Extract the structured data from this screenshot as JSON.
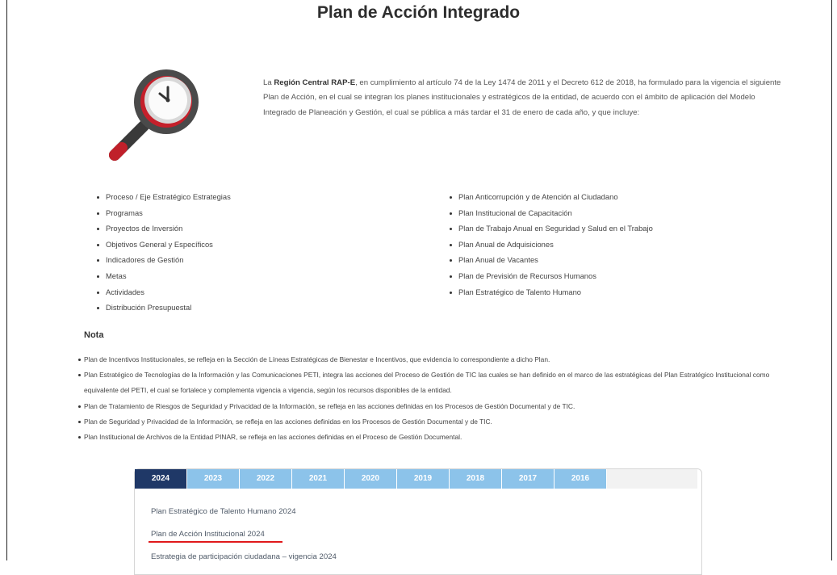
{
  "page": {
    "title": "Plan de Acción Integrado",
    "icon": "magnifier-clock-icon"
  },
  "intro": {
    "prefix": "La ",
    "org": "Región Central RAP-E",
    "text": ", en cumplimiento al artículo 74 de la Ley 1474 de 2011 y el Decreto 612 de 2018, ha formulado para la vigencia el siguiente Plan de Acción, en el cual se integran los planes institucionales y estratégicos de la entidad, de acuerdo con el ámbito de aplicación del Modelo Integrado de Planeación y Gestión, el cual se pública a más tardar el 31 de enero de cada año, y que incluye:"
  },
  "list_left": [
    "Proceso / Eje Estratégico Estrategias",
    "Programas",
    "Proyectos de Inversión",
    "Objetivos General y Específicos",
    "Indicadores de Gestión",
    "Metas",
    "Actividades",
    "Distribución Presupuestal"
  ],
  "list_right": [
    "Plan Anticorrupción y de Atención al Ciudadano",
    "Plan Institucional de Capacitación",
    "Plan de Trabajo Anual en Seguridad y Salud en el Trabajo",
    "Plan Anual de Adquisiciones",
    "Plan Anual de Vacantes",
    "Plan de Previsión de Recursos Humanos",
    "Plan Estratégico de Talento Humano"
  ],
  "nota": {
    "heading": "Nota",
    "items": [
      "Plan de Incentivos Institucionales, se refleja en la Sección de Líneas Estratégicas de Bienestar e Incentivos, que evidencia lo correspondiente a dicho Plan.",
      "Plan Estratégico de Tecnologías de la Información y las Comunicaciones PETI, integra las acciones del Proceso de Gestión de TIC las cuales se han definido en el marco de las estratégicas del Plan Estratégico Institucional como equivalente del PETI, el cual se fortalece y complementa vigencia a vigencia, según los recursos disponibles de la entidad.",
      "Plan de Tratamiento de Riesgos de Seguridad y Privacidad de la Información, se refleja en las acciones definidas en los Procesos de Gestión Documental y de TIC.",
      "Plan de Seguridad y Privacidad de la Información, se refleja en las acciones definidas en los Procesos de Gestión Documental y de TIC.",
      "Plan Institucional de Archivos de la Entidad PINAR, se refleja en las acciones definidas en el Proceso de Gestión Documental."
    ]
  },
  "tabs": {
    "years": [
      "2024",
      "2023",
      "2022",
      "2021",
      "2020",
      "2019",
      "2018",
      "2017",
      "2016"
    ],
    "active": "2024",
    "links": [
      "Plan Estratégico de Talento Humano 2024",
      "Plan de Acción Institucional 2024",
      "Estrategia de participación ciudadana – vigencia 2024"
    ]
  },
  "colors": {
    "tab_active": "#1f3867",
    "tab_inactive": "#8cc3ea",
    "highlight_underline": "#e0191b"
  }
}
